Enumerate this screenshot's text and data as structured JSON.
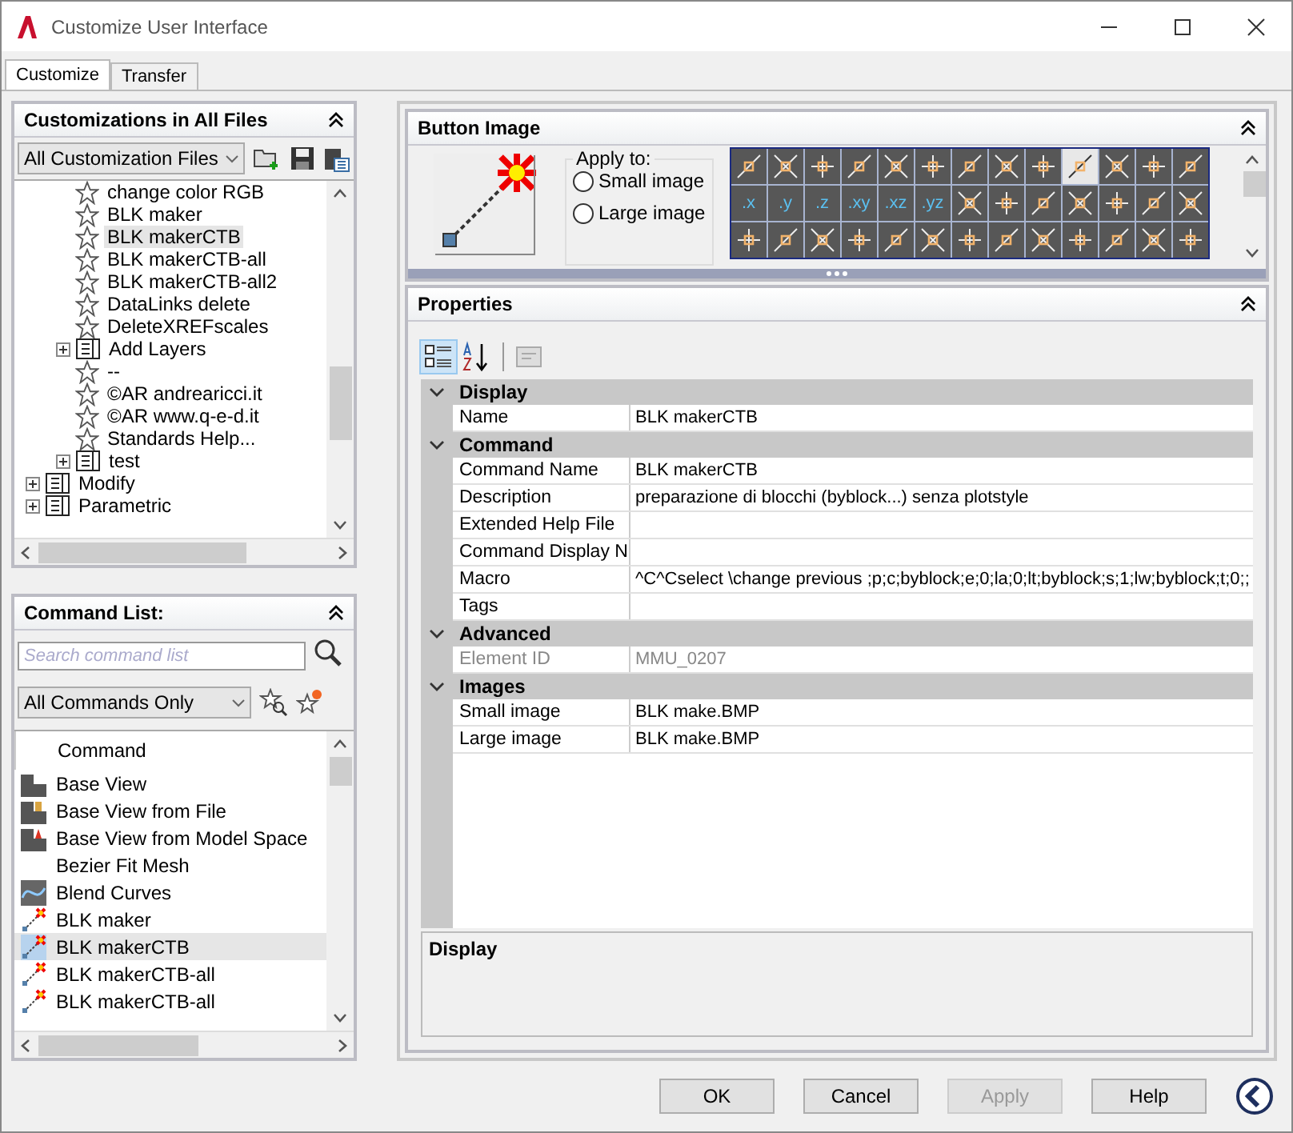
{
  "window": {
    "title": "Customize User Interface"
  },
  "tabs": [
    {
      "label": "Customize",
      "selected": true
    },
    {
      "label": "Transfer",
      "selected": false
    }
  ],
  "customizations": {
    "title": "Customizations in All Files",
    "filter": "All Customization Files",
    "tree": [
      {
        "children": [
          {
            "children": [
              {
                "kind": "command",
                "label": "change color RGB",
                "selected": false
              },
              {
                "kind": "command",
                "label": "BLK maker",
                "selected": false
              },
              {
                "kind": "command",
                "label": "BLK makerCTB",
                "selected": true
              },
              {
                "kind": "command",
                "label": "BLK makerCTB-all",
                "selected": false
              },
              {
                "kind": "command",
                "label": "BLK makerCTB-all2",
                "selected": false
              },
              {
                "kind": "command",
                "label": "DataLinks delete",
                "selected": false
              },
              {
                "kind": "command",
                "label": "DeleteXREFscales",
                "selected": false
              },
              {
                "kind": "menu",
                "label": "Add Layers",
                "selected": false
              },
              {
                "kind": "command",
                "label": "--",
                "selected": false
              },
              {
                "kind": "command",
                "label": "©AR andrearicci.it",
                "selected": false
              },
              {
                "kind": "command",
                "label": "©AR www.q-e-d.it",
                "selected": false
              },
              {
                "kind": "command",
                "label": "Standards Help...",
                "selected": false
              },
              {
                "kind": "menu",
                "label": "test",
                "selected": false
              }
            ]
          },
          {
            "kind": "menu",
            "label": "Modify",
            "selected": false
          },
          {
            "kind": "menu",
            "label": "Parametric",
            "selected": false
          }
        ]
      }
    ]
  },
  "command_list": {
    "title": "Command List:",
    "search": {
      "placeholder": "Search command list"
    },
    "filter": "All Commands Only",
    "column": "Command",
    "items": [
      {
        "label": "Base View",
        "kind": "view",
        "selected": false
      },
      {
        "label": "Base View from File",
        "kind": "view-file",
        "selected": false
      },
      {
        "label": "Base View from Model Space",
        "kind": "view-model",
        "selected": false
      },
      {
        "label": "Bezier Fit Mesh",
        "kind": "none",
        "selected": false
      },
      {
        "label": "Blend Curves",
        "kind": "curve",
        "selected": false
      },
      {
        "label": "BLK maker",
        "kind": "blk",
        "selected": false
      },
      {
        "label": "BLK makerCTB",
        "kind": "blk",
        "selected": true
      },
      {
        "label": "BLK makerCTB-all",
        "kind": "blk",
        "selected": false
      },
      {
        "label": "BLK makerCTB-all",
        "kind": "blk",
        "selected": false
      }
    ]
  },
  "button_image": {
    "title": "Button Image",
    "apply_to": "Apply to:",
    "options": [
      {
        "label": "Small image",
        "selected": false
      },
      {
        "label": "Large image",
        "selected": false
      }
    ],
    "icons": [
      {
        "kind": "glyph",
        "selected": false
      },
      {
        "kind": "glyph",
        "selected": false
      },
      {
        "kind": "glyph",
        "selected": false
      },
      {
        "kind": "glyph",
        "selected": false
      },
      {
        "kind": "glyph",
        "selected": false
      },
      {
        "kind": "glyph",
        "selected": false
      },
      {
        "kind": "glyph",
        "selected": false
      },
      {
        "kind": "glyph",
        "selected": false
      },
      {
        "kind": "glyph",
        "selected": false
      },
      {
        "kind": "glyph",
        "selected": true
      },
      {
        "kind": "glyph",
        "selected": false
      },
      {
        "kind": "glyph",
        "selected": false
      },
      {
        "kind": "glyph",
        "selected": false
      },
      {
        "kind": "text",
        "label": ".x",
        "selected": false
      },
      {
        "kind": "text",
        "label": ".y",
        "selected": false
      },
      {
        "kind": "text",
        "label": ".z",
        "selected": false
      },
      {
        "kind": "text",
        "label": ".xy",
        "selected": false
      },
      {
        "kind": "text",
        "label": ".xz",
        "selected": false
      },
      {
        "kind": "text",
        "label": ".yz",
        "selected": false
      },
      {
        "kind": "glyph",
        "selected": false
      },
      {
        "kind": "glyph",
        "selected": false
      },
      {
        "kind": "glyph",
        "selected": false
      },
      {
        "kind": "glyph",
        "selected": false
      },
      {
        "kind": "glyph",
        "selected": false
      },
      {
        "kind": "glyph",
        "selected": false
      },
      {
        "kind": "glyph",
        "selected": false
      },
      {
        "kind": "glyph",
        "selected": false
      },
      {
        "kind": "glyph",
        "selected": false
      },
      {
        "kind": "glyph",
        "selected": false
      },
      {
        "kind": "glyph",
        "selected": false
      },
      {
        "kind": "glyph",
        "selected": false
      },
      {
        "kind": "glyph",
        "selected": false
      },
      {
        "kind": "glyph",
        "selected": false
      },
      {
        "kind": "glyph",
        "selected": false
      },
      {
        "kind": "glyph",
        "selected": false
      },
      {
        "kind": "glyph",
        "selected": false
      },
      {
        "kind": "glyph",
        "selected": false
      },
      {
        "kind": "glyph",
        "selected": false
      },
      {
        "kind": "glyph",
        "selected": false
      }
    ]
  },
  "properties": {
    "title": "Properties",
    "categories": [
      {
        "name": "Display",
        "expanded": true,
        "rows": [
          {
            "name": "Name",
            "value": "BLK makerCTB",
            "disabled": false
          }
        ]
      },
      {
        "name": "Command",
        "expanded": true,
        "rows": [
          {
            "name": "Command Name",
            "value": "BLK makerCTB",
            "disabled": false
          },
          {
            "name": "Description",
            "value": "preparazione di blocchi (byblock...) senza plotstyle",
            "disabled": false
          },
          {
            "name": "Extended Help File",
            "disabled": false
          },
          {
            "name": "Command Display N",
            "disabled": false
          },
          {
            "name": "Macro",
            "value": "^C^Cselect \\change previous ;p;c;byblock;e;0;la;0;lt;byblock;s;1;lw;byblock;t;0;;",
            "disabled": false
          },
          {
            "name": "Tags",
            "disabled": false
          }
        ]
      },
      {
        "name": "Advanced",
        "expanded": true,
        "rows": [
          {
            "name": "Element ID",
            "value": "MMU_0207",
            "disabled": true
          }
        ]
      },
      {
        "name": "Images",
        "expanded": true,
        "rows": [
          {
            "name": "Small image",
            "value": "BLK make.BMP",
            "disabled": false
          },
          {
            "name": "Large image",
            "value": "BLK make.BMP",
            "disabled": false
          }
        ]
      }
    ],
    "description_title": "Display"
  },
  "buttons": [
    {
      "label": "OK",
      "disabled": false
    },
    {
      "label": "Cancel",
      "disabled": false
    },
    {
      "label": "Apply",
      "disabled": true
    },
    {
      "label": "Help",
      "disabled": false
    }
  ]
}
